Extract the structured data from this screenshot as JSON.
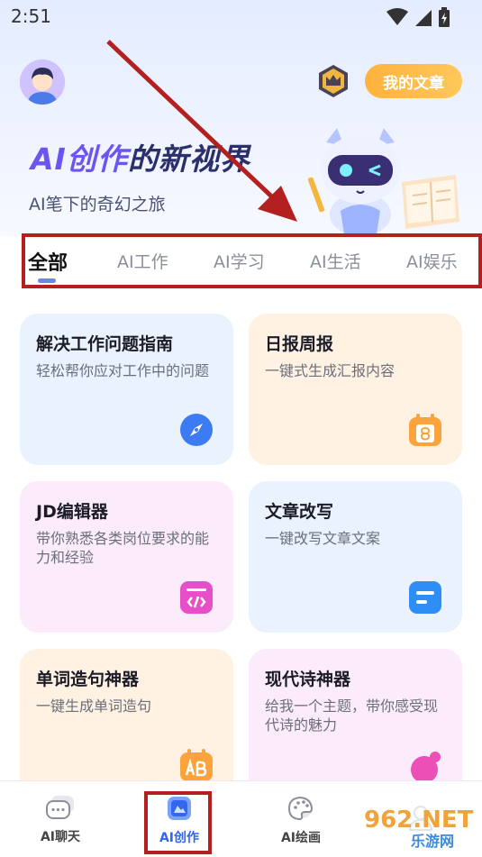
{
  "status": {
    "time": "2:51"
  },
  "header": {
    "my_articles_label": "我的文章",
    "title_ai": "AI创作",
    "title_rest": "的新视界",
    "subtitle": "AI笔下的奇幻之旅"
  },
  "tabs": [
    {
      "label": "全部",
      "active": true
    },
    {
      "label": "AI工作",
      "active": false
    },
    {
      "label": "AI学习",
      "active": false
    },
    {
      "label": "AI生活",
      "active": false
    },
    {
      "label": "AI娱乐",
      "active": false
    }
  ],
  "cards": [
    {
      "title": "解决工作问题指南",
      "desc": "轻松帮你应对工作中的问题",
      "icon": "compass-icon"
    },
    {
      "title": "日报周报",
      "desc": "一键式生成汇报内容",
      "icon": "calendar-icon"
    },
    {
      "title": "JD编辑器",
      "desc": "带你熟悉各类岗位要求的能力和经验",
      "icon": "code-icon"
    },
    {
      "title": "文章改写",
      "desc": "一键改写文章文案",
      "icon": "document-icon"
    },
    {
      "title": "单词造句神器",
      "desc": "一键生成单词造句",
      "icon": "ab-icon"
    },
    {
      "title": "现代诗神器",
      "desc": "给我一个主题，带你感受现代诗的魅力",
      "icon": "quill-icon"
    }
  ],
  "bottom_nav": [
    {
      "label": "AI聊天",
      "icon": "chat-icon",
      "active": false
    },
    {
      "label": "AI创作",
      "icon": "creation-icon",
      "active": true
    },
    {
      "label": "AI绘画",
      "icon": "palette-icon",
      "active": false
    },
    {
      "label": "",
      "icon": "profile-icon",
      "active": false
    }
  ],
  "watermark": {
    "text_main": "962.NET",
    "text_sub": "乐游网"
  },
  "colors": {
    "accent": "#2f64f5",
    "highlight_box": "#b3201f",
    "my_articles_bg": "#ffb23d",
    "title_ai": "#6c54f0",
    "title_rest": "#2b2f6b"
  }
}
